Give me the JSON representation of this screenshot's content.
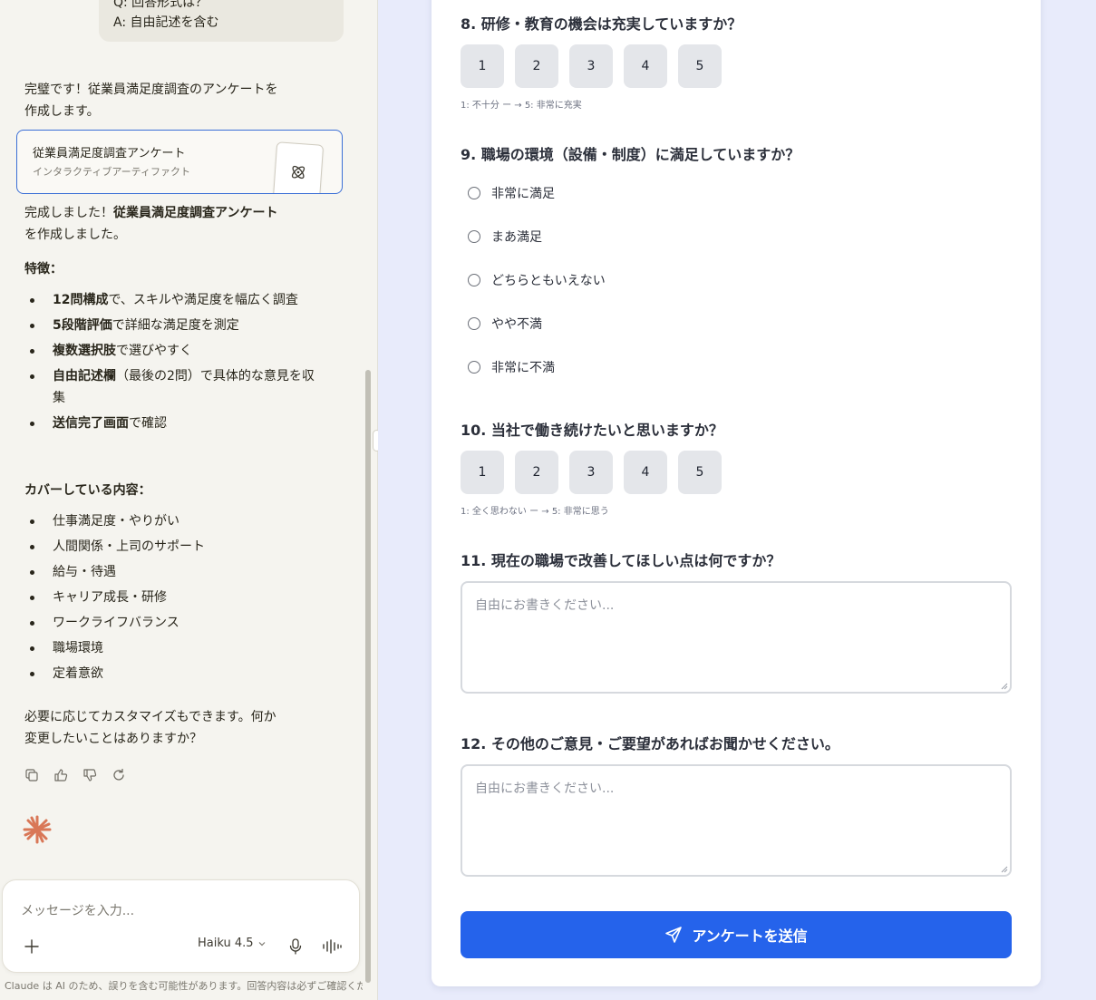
{
  "chat": {
    "user_message_lines": [
      "Q: 回答形式は？",
      "A: 自由記述を含む"
    ],
    "assistant_intro": [
      "完璧です！従業員満足度調査のアンケートを",
      "作成します。"
    ],
    "artifact": {
      "title": "従業員満足度調査アンケート",
      "subtitle": "インタラクティブアーティファクト"
    },
    "completion_prefix": "完成しました！",
    "completion_bold": "従業員満足度調査アンケート",
    "completion_suffix": "を作成しました。",
    "features_heading": "特徴：",
    "features": [
      {
        "bold": "12問構成",
        "text": "で、スキルや満足度を幅広く調査"
      },
      {
        "bold": "5段階評価",
        "text": "で詳細な満足度を測定"
      },
      {
        "bold": "複数選択肢",
        "text": "で選びやすく"
      },
      {
        "bold": "自由記述欄",
        "text": "（最後の2問）で具体的な意見を収集"
      },
      {
        "bold": "送信完了画面",
        "text": "で確認"
      }
    ],
    "coverage_heading": "カバーしている内容：",
    "coverage": [
      "仕事満足度・やりがい",
      "人間関係・上司のサポート",
      "給与・待遇",
      "キャリア成長・研修",
      "ワークライフバランス",
      "職場環境",
      "定着意欲"
    ],
    "closing": [
      "必要に応じてカスタマイズもできます。何か",
      "変更したいことはありますか？"
    ],
    "input_placeholder": "メッセージを入力...",
    "model_name": "Haiku 4.5",
    "disclaimer": "Claude は AI のため、誤りを含む可能性があります。回答内容は必ずご確認ください。"
  },
  "form": {
    "q8": {
      "label": "8. 研修・教育の機会は充実していますか？",
      "options": [
        "1",
        "2",
        "3",
        "4",
        "5"
      ],
      "hint": "1: 不十分 ー → 5: 非常に充実"
    },
    "q9": {
      "label": "9. 職場の環境（設備・制度）に満足していますか？",
      "options": [
        "非常に満足",
        "まあ満足",
        "どちらともいえない",
        "やや不満",
        "非常に不満"
      ]
    },
    "q10": {
      "label": "10. 当社で働き続けたいと思いますか？",
      "options": [
        "1",
        "2",
        "3",
        "4",
        "5"
      ],
      "hint": "1: 全く思わない ー → 5: 非常に思う"
    },
    "q11": {
      "label": "11. 現在の職場で改善してほしい点は何ですか？",
      "placeholder": "自由にお書きください..."
    },
    "q12": {
      "label": "12. その他のご意見・ご要望があればお聞かせください。",
      "placeholder": "自由にお書きください..."
    },
    "submit_label": "アンケートを送信"
  },
  "colors": {
    "accent_blue": "#2563eb",
    "claude_orange": "#d97757",
    "artifact_border": "#3b6fd6"
  },
  "icons": [
    "copy-icon",
    "thumbs-up-icon",
    "thumbs-down-icon",
    "retry-icon",
    "claude-spark-icon",
    "plus-icon",
    "chevron-down-icon",
    "microphone-icon",
    "voice-wave-icon",
    "send-icon",
    "artifact-atom-icon"
  ]
}
